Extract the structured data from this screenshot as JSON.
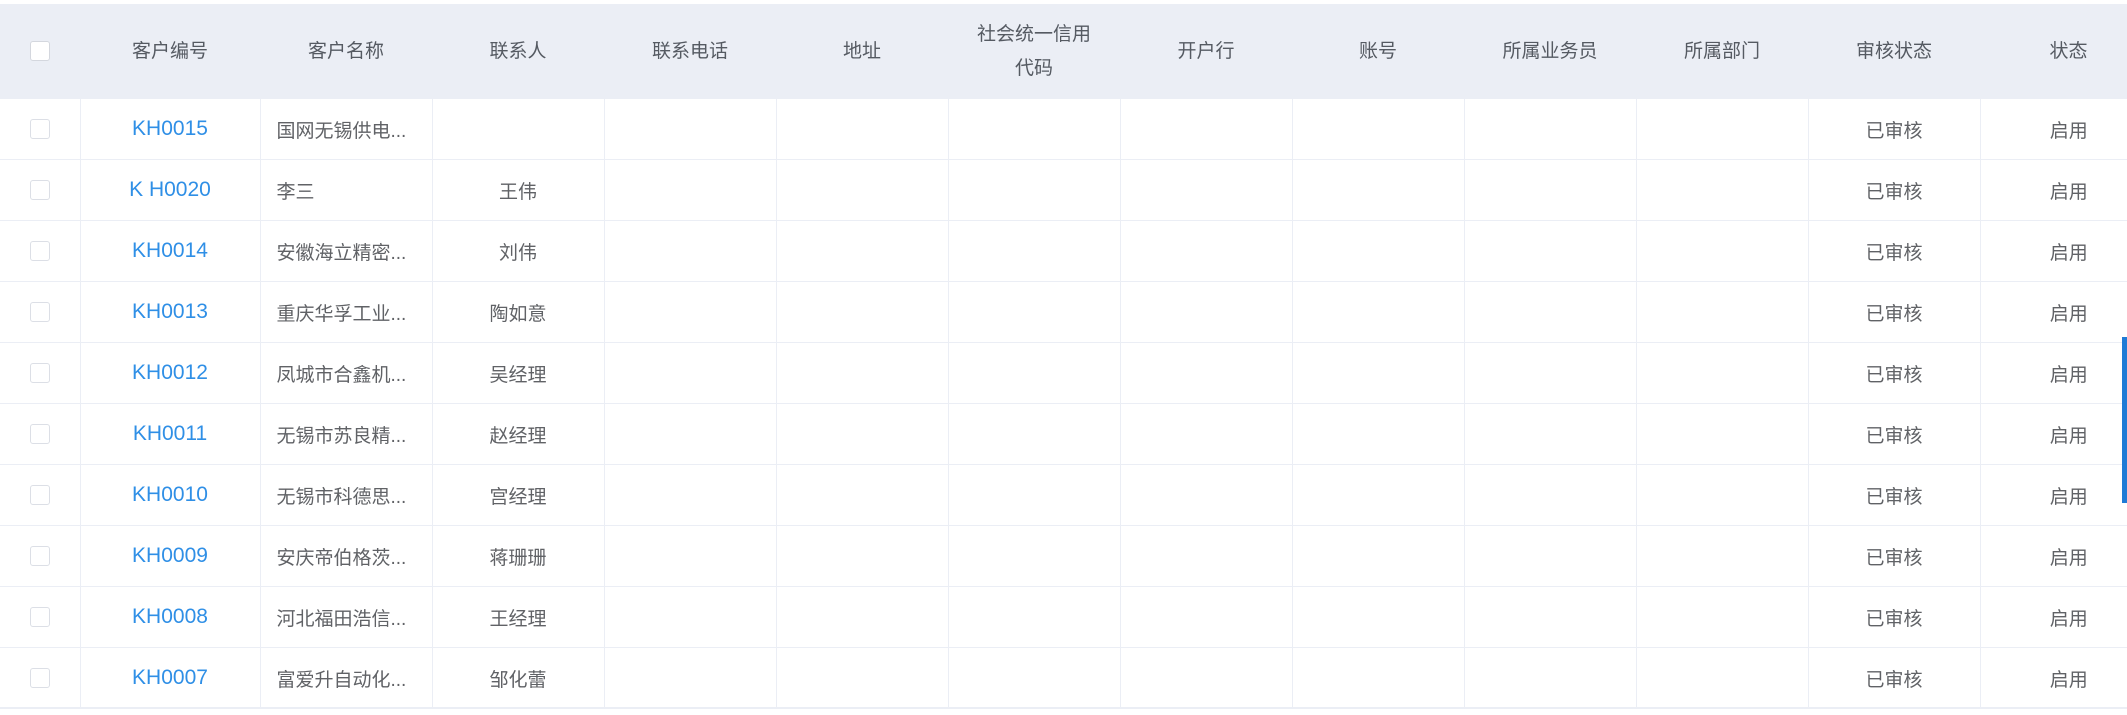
{
  "table": {
    "headers": [
      "",
      "客户编号",
      "客户名称",
      "联系人",
      "联系电话",
      "地址",
      "社会统一信用代码",
      "开户行",
      "账号",
      "所属业务员",
      "所属部门",
      "审核状态",
      "状态"
    ],
    "rows": [
      {
        "code": "KH0015",
        "name": "国网无锡供电...",
        "contact": "",
        "phone": "",
        "address": "",
        "credit_code": "",
        "bank": "",
        "account": "",
        "salesman": "",
        "department": "",
        "audit": "已审核",
        "status": "启用"
      },
      {
        "code": "K H0020",
        "name": "李三",
        "contact": "王伟",
        "phone": "",
        "address": "",
        "credit_code": "",
        "bank": "",
        "account": "",
        "salesman": "",
        "department": "",
        "audit": "已审核",
        "status": "启用"
      },
      {
        "code": "KH0014",
        "name": "安徽海立精密...",
        "contact": "刘伟",
        "phone": "",
        "address": "",
        "credit_code": "",
        "bank": "",
        "account": "",
        "salesman": "",
        "department": "",
        "audit": "已审核",
        "status": "启用"
      },
      {
        "code": "KH0013",
        "name": "重庆华孚工业...",
        "contact": "陶如意",
        "phone": "",
        "address": "",
        "credit_code": "",
        "bank": "",
        "account": "",
        "salesman": "",
        "department": "",
        "audit": "已审核",
        "status": "启用"
      },
      {
        "code": "KH0012",
        "name": "凤城市合鑫机...",
        "contact": "吴经理",
        "phone": "",
        "address": "",
        "credit_code": "",
        "bank": "",
        "account": "",
        "salesman": "",
        "department": "",
        "audit": "已审核",
        "status": "启用"
      },
      {
        "code": "KH0011",
        "name": "无锡市苏良精...",
        "contact": "赵经理",
        "phone": "",
        "address": "",
        "credit_code": "",
        "bank": "",
        "account": "",
        "salesman": "",
        "department": "",
        "audit": "已审核",
        "status": "启用"
      },
      {
        "code": "KH0010",
        "name": "无锡市科德思...",
        "contact": "宫经理",
        "phone": "",
        "address": "",
        "credit_code": "",
        "bank": "",
        "account": "",
        "salesman": "",
        "department": "",
        "audit": "已审核",
        "status": "启用"
      },
      {
        "code": "KH0009",
        "name": "安庆帝伯格茨...",
        "contact": "蒋珊珊",
        "phone": "",
        "address": "",
        "credit_code": "",
        "bank": "",
        "account": "",
        "salesman": "",
        "department": "",
        "audit": "已审核",
        "status": "启用"
      },
      {
        "code": "KH0008",
        "name": "河北福田浩信...",
        "contact": "王经理",
        "phone": "",
        "address": "",
        "credit_code": "",
        "bank": "",
        "account": "",
        "salesman": "",
        "department": "",
        "audit": "已审核",
        "status": "启用"
      },
      {
        "code": "KH0007",
        "name": "富爱升自动化...",
        "contact": "邹化蕾",
        "phone": "",
        "address": "",
        "credit_code": "",
        "bank": "",
        "account": "",
        "salesman": "",
        "department": "",
        "audit": "已审核",
        "status": "启用"
      }
    ]
  },
  "colors": {
    "link": "#2f8fe6",
    "header_bg": "#ebeef5",
    "scroll_accent": "#1f7bd6"
  }
}
